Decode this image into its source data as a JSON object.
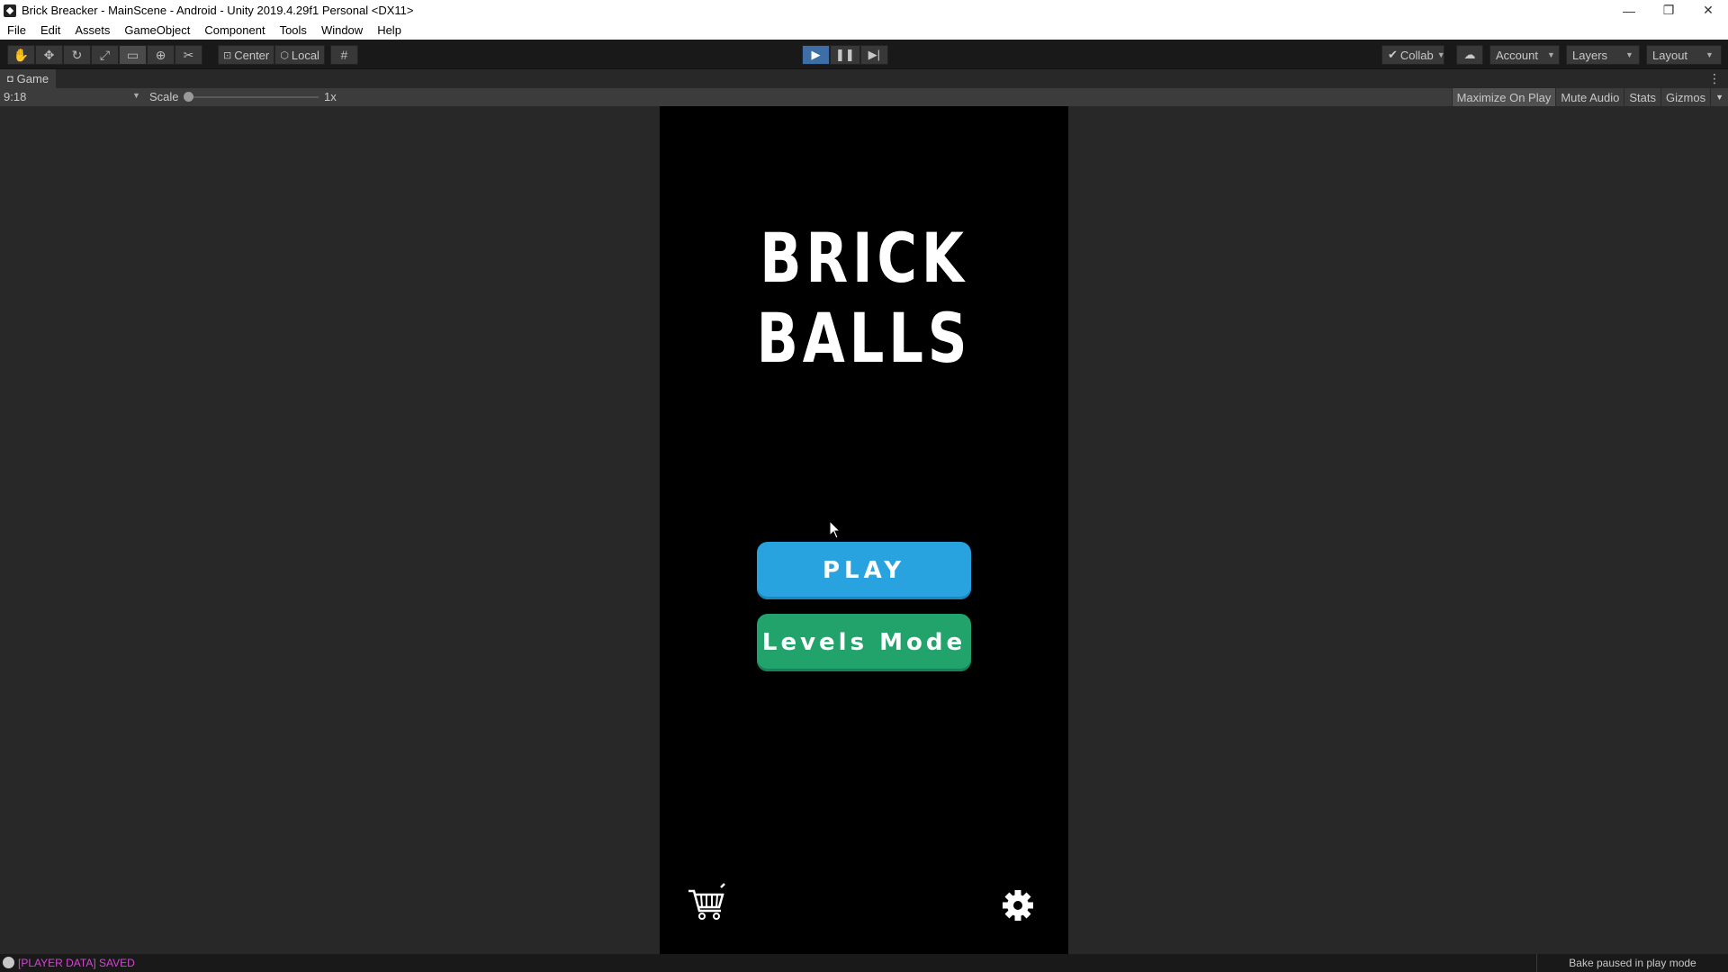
{
  "window": {
    "title": "Brick Breacker - MainScene - Android - Unity 2019.4.29f1 Personal <DX11>",
    "controls": [
      "—",
      "❐",
      "✕"
    ]
  },
  "menu": [
    "File",
    "Edit",
    "Assets",
    "GameObject",
    "Component",
    "Tools",
    "Window",
    "Help"
  ],
  "toolbar": {
    "tools": [
      "hand-icon",
      "move-icon",
      "rotate-icon",
      "scale-icon",
      "rect-icon",
      "transform-icon",
      "custom-tool-icon"
    ],
    "pivot_mode": "Center",
    "pivot_rotation": "Local",
    "collab": "Collab",
    "account": "Account",
    "layers": "Layers",
    "layout": "Layout"
  },
  "game_panel": {
    "tab": "Game",
    "aspect": "9:18",
    "scale_label": "Scale",
    "scale_value": "1x",
    "buttons": [
      "Maximize On Play",
      "Mute Audio",
      "Stats",
      "Gizmos"
    ]
  },
  "game": {
    "title": "BRICK BALLS",
    "play_button": "PLAY",
    "levels_button": "Levels Mode",
    "colors": {
      "play": "#29a3df",
      "levels": "#21a36b",
      "background": "#000000"
    }
  },
  "status": {
    "log": "[PLAYER DATA] SAVED",
    "bake": "Bake paused in play mode"
  }
}
